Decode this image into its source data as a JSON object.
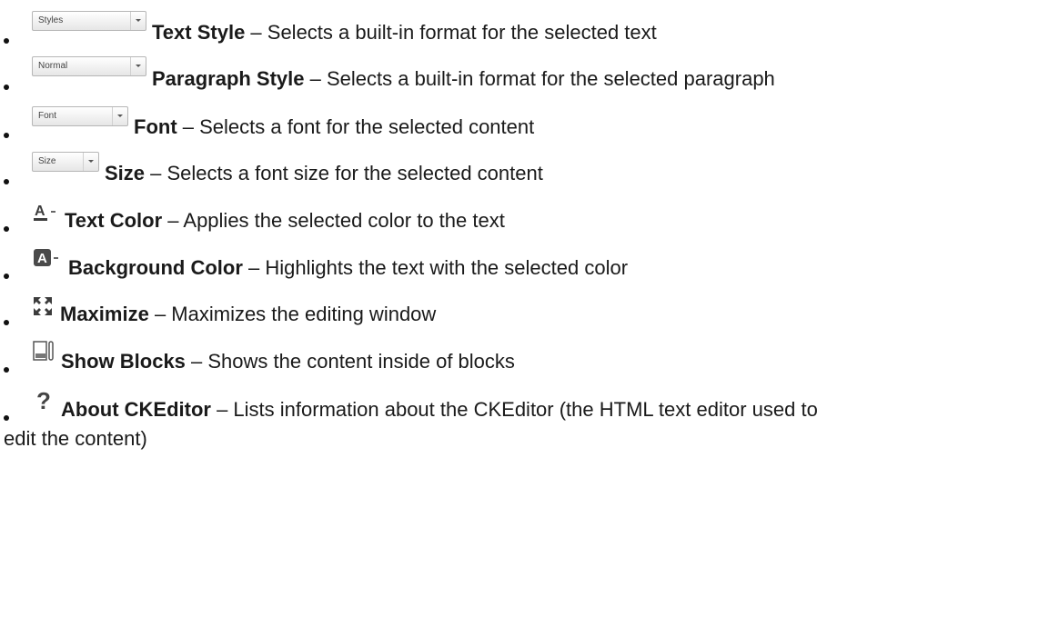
{
  "items": [
    {
      "control": "Styles",
      "name": "Text Style",
      "desc": " – Selects a built-in format for the selected text"
    },
    {
      "control": "Normal",
      "name": "Paragraph Style",
      "desc": " – Selects a built-in format for the selected paragraph"
    },
    {
      "control": "Font",
      "name": "Font",
      "desc": " – Selects a font for the selected content"
    },
    {
      "control": "Size",
      "name": "Size",
      "desc": " – Selects a font size for the selected content"
    },
    {
      "icon": "text-color-icon",
      "name": "Text Color",
      "desc": " – Applies the selected color to the text"
    },
    {
      "icon": "background-color-icon",
      "name": "Background Color",
      "desc": " – Highlights the text with the selected color"
    },
    {
      "icon": "maximize-icon",
      "name": "Maximize",
      "desc": " – Maximizes the editing window"
    },
    {
      "icon": "show-blocks-icon",
      "name": "Show Blocks",
      "desc": " – Shows the content inside of blocks"
    },
    {
      "icon": "about-icon",
      "name": "About CKEditor",
      "desc": " – Lists information about the CKEditor (the HTML text editor used to",
      "desc_cont": "edit the content)"
    }
  ],
  "icon_glyphs": {
    "text_color": "A",
    "background_color": "A",
    "about": "?"
  }
}
